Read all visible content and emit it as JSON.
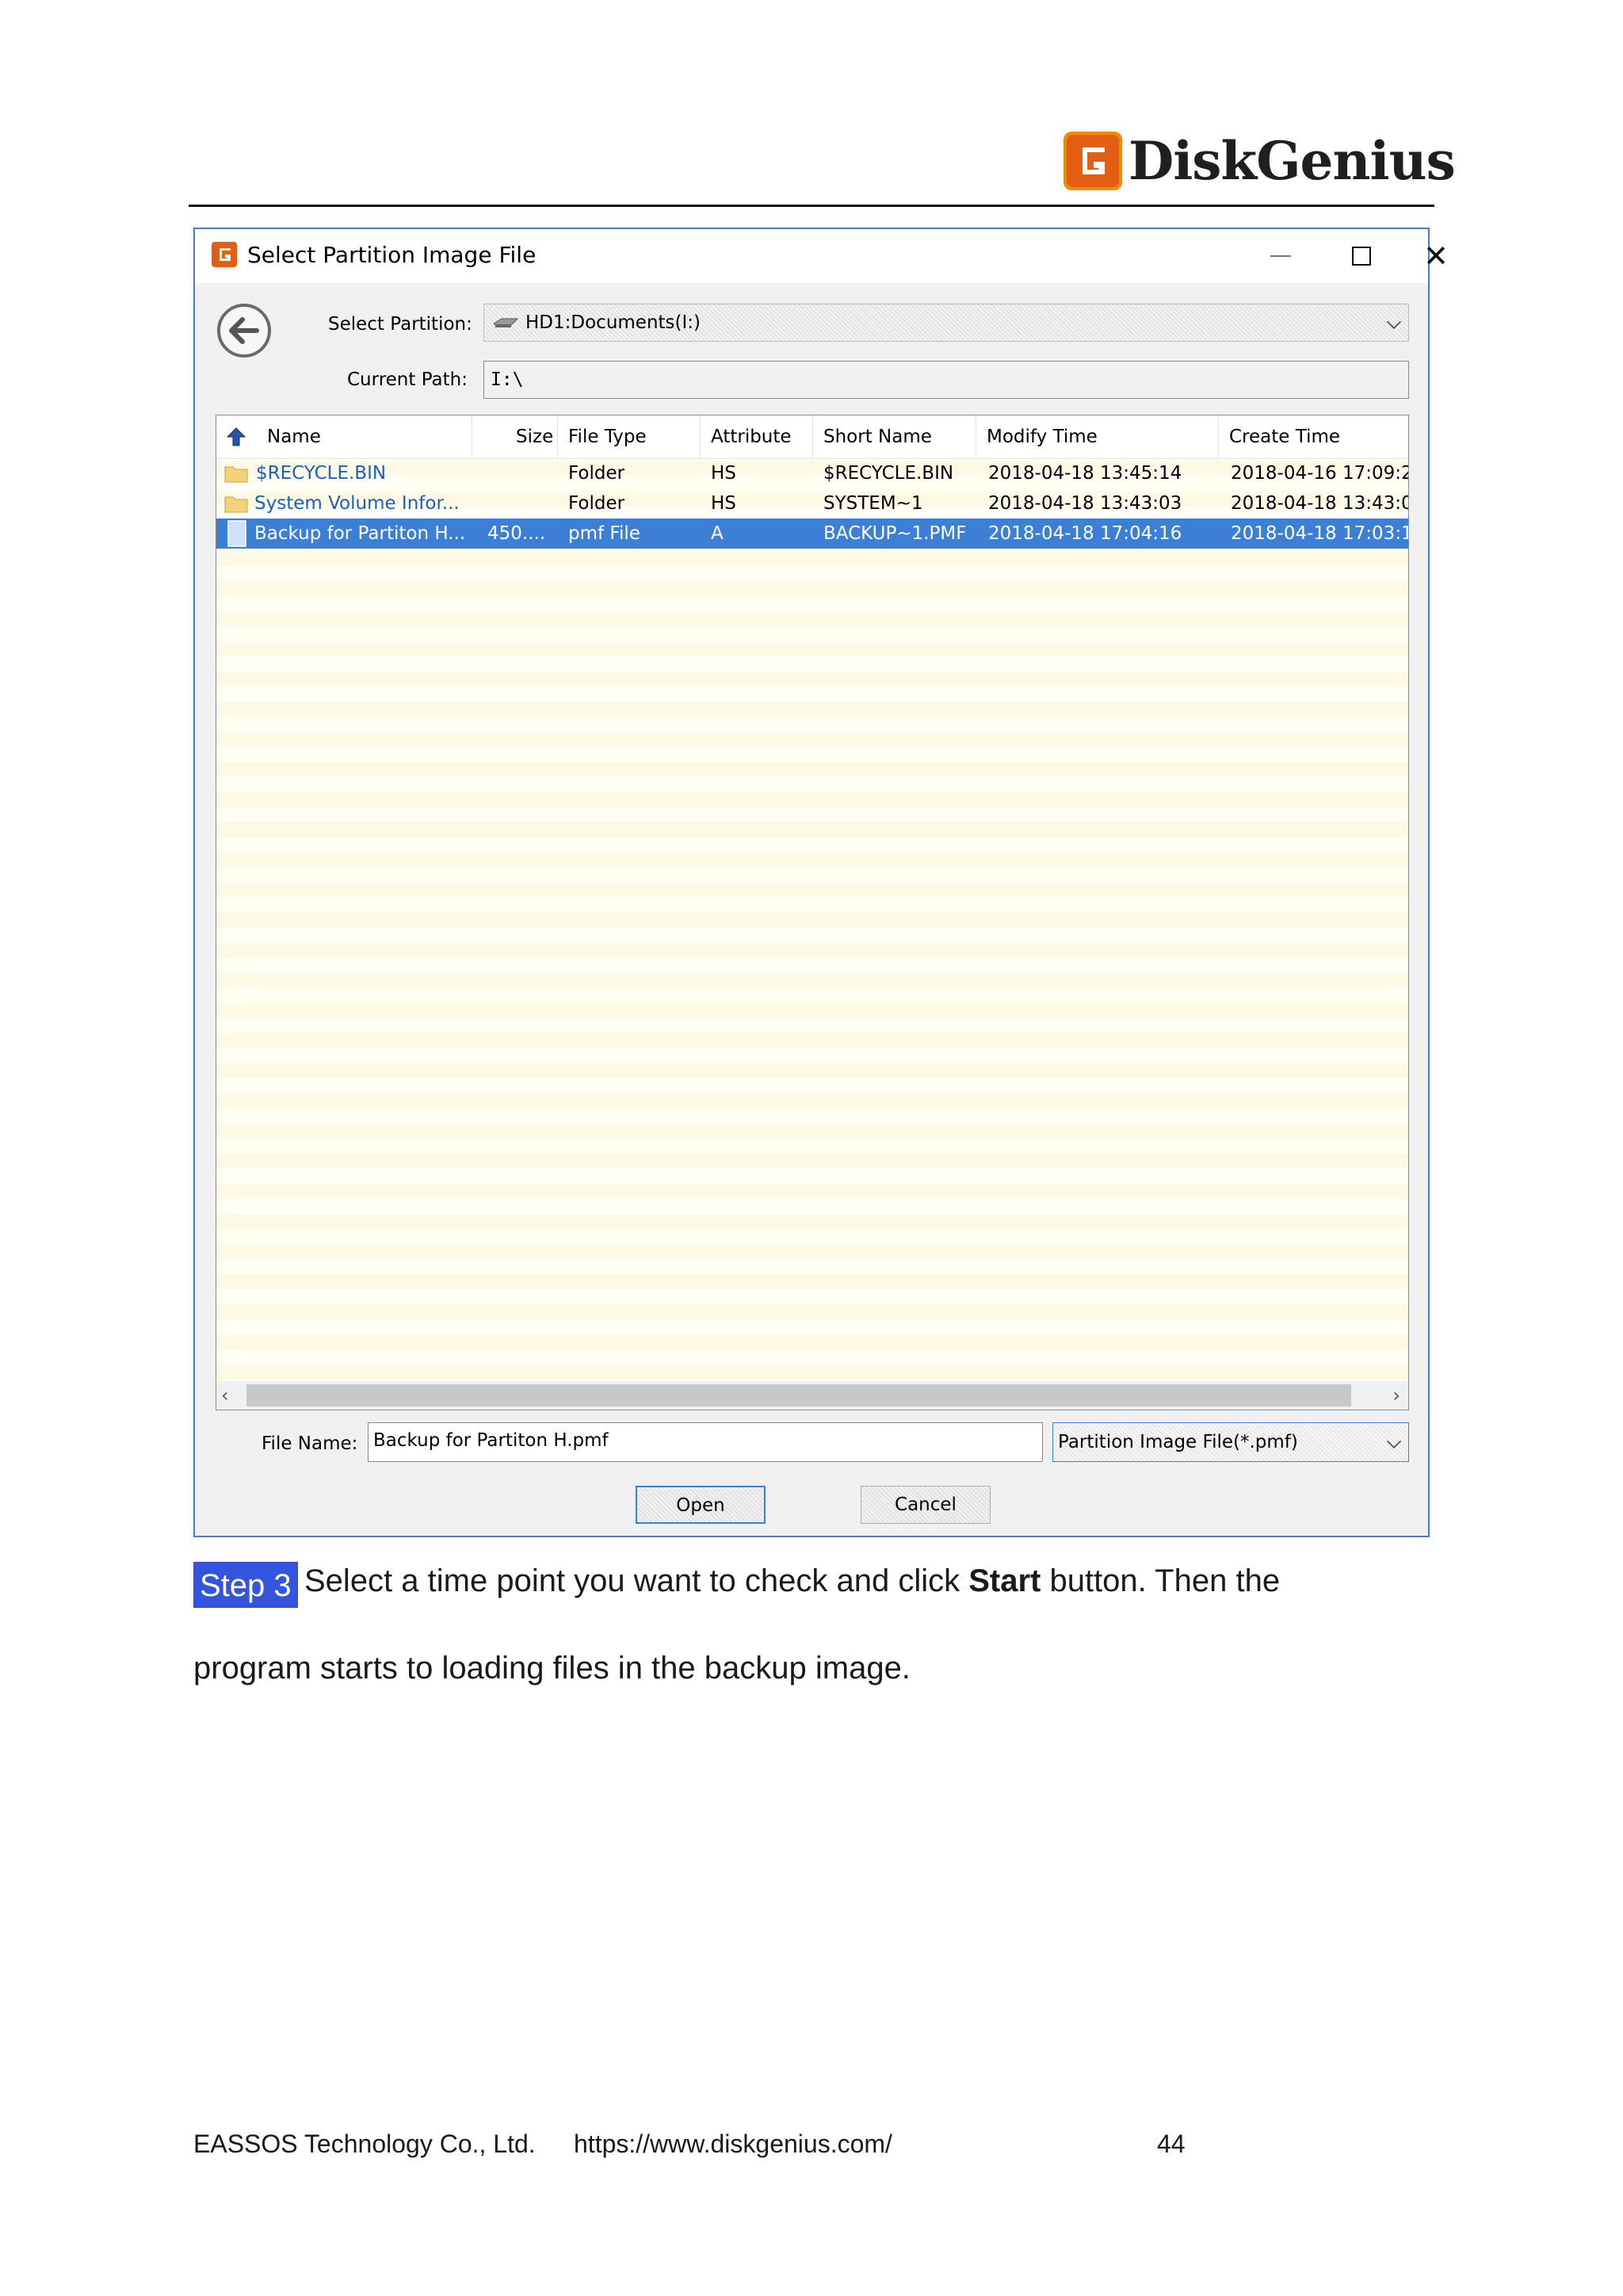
{
  "header": {
    "logo_text": "DiskGenius",
    "logo_color": "#f08a00"
  },
  "dialog": {
    "title": "Select Partition Image File",
    "select_partition_label": "Select Partition:",
    "select_partition_value": "HD1:Documents(I:)",
    "current_path_label": "Current Path:",
    "current_path_value": "I:\\",
    "columns": [
      "Name",
      "Size",
      "File Type",
      "Attribute",
      "Short Name",
      "Modify Time",
      "Create Time"
    ],
    "rows": [
      {
        "name": "$RECYCLE.BIN",
        "size": "",
        "type": "Folder",
        "attr": "HS",
        "short": "$RECYCLE.BIN",
        "modify": "2018-04-18 13:45:14",
        "create": "2018-04-16 17:09:2",
        "icon": "folder-icon"
      },
      {
        "name": "System Volume Infor...",
        "size": "",
        "type": "Folder",
        "attr": "HS",
        "short": "SYSTEM~1",
        "modify": "2018-04-18 13:43:03",
        "create": "2018-04-18 13:43:0",
        "icon": "folder-icon"
      },
      {
        "name": "Backup for Partiton H...",
        "size": "450....",
        "type": "pmf File",
        "attr": "A",
        "short": "BACKUP~1.PMF",
        "modify": "2018-04-18 17:04:16",
        "create": "2018-04-18 17:03:1",
        "icon": "file-icon",
        "selected": true
      }
    ],
    "file_name_label": "File Name:",
    "file_name_value": "Backup for Partiton H.pmf",
    "file_type_value": "Partition Image File(*.pmf)",
    "open_label": "Open",
    "cancel_label": "Cancel",
    "accent_color": "#3b7fd7"
  },
  "body": {
    "step_label": "Step 3",
    "line1_pre": "Select a time point you want to check and click ",
    "line1_bold": "Start",
    "line1_post": " button. Then the",
    "line2": "program starts to loading files in the backup image."
  },
  "footer": {
    "company": "EASSOS Technology Co., Ltd.",
    "url": "https://www.diskgenius.com/",
    "page": "44"
  }
}
